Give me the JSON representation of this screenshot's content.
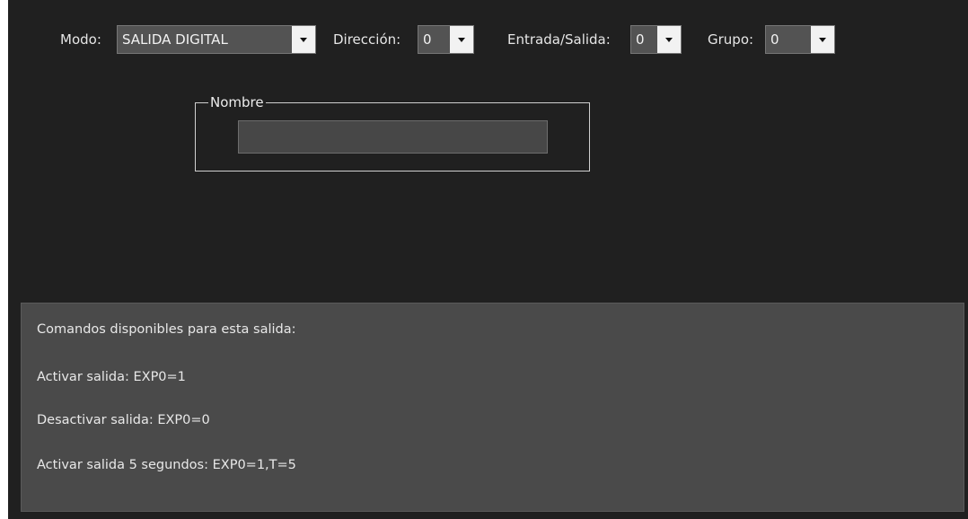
{
  "toolbar": {
    "modo": {
      "label": "Modo:",
      "value": "SALIDA DIGITAL"
    },
    "direccion": {
      "label": "Dirección:",
      "value": "0"
    },
    "entrada_salida": {
      "label": "Entrada/Salida:",
      "value": "0"
    },
    "grupo": {
      "label": "Grupo:",
      "value": "0"
    }
  },
  "nombre": {
    "legend": "Nombre",
    "value": ""
  },
  "commands": {
    "title": "Comandos disponibles para esta salida:",
    "lines": [
      "Activar salida: EXP0=1",
      "Desactivar salida: EXP0=0",
      "Activar salida 5 segundos: EXP0=1,T=5"
    ]
  },
  "icons": {
    "dropdown": "chevron-down-icon"
  }
}
